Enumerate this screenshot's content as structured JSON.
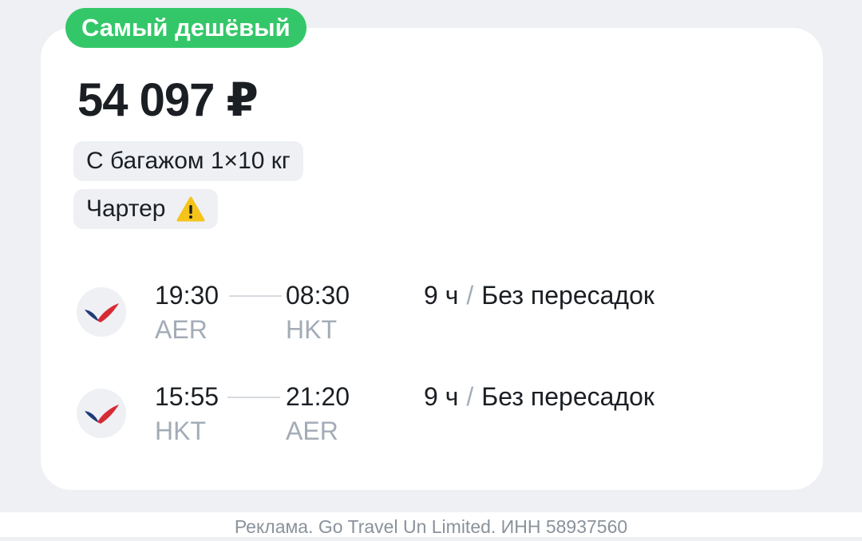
{
  "offer": {
    "badge": "Самый дешёвый",
    "price": "54 097 ₽",
    "baggage": "С багажом 1×10 кг",
    "charter": "Чартер",
    "warning_icon": "warning-triangle-icon",
    "accent_color": "#34c769"
  },
  "segments": [
    {
      "airline_logo": "airline-logo-icon",
      "depart_time": "19:30",
      "arrive_time": "08:30",
      "depart_code": "AER",
      "arrive_code": "HKT",
      "duration": "9 ч",
      "stops": "Без пересадок"
    },
    {
      "airline_logo": "airline-logo-icon",
      "depart_time": "15:55",
      "arrive_time": "21:20",
      "depart_code": "HKT",
      "arrive_code": "AER",
      "duration": "9 ч",
      "stops": "Без пересадок"
    }
  ],
  "footer": {
    "ad_text": "Реклама. Go Travel Un Limited. ИНН 58937560"
  }
}
